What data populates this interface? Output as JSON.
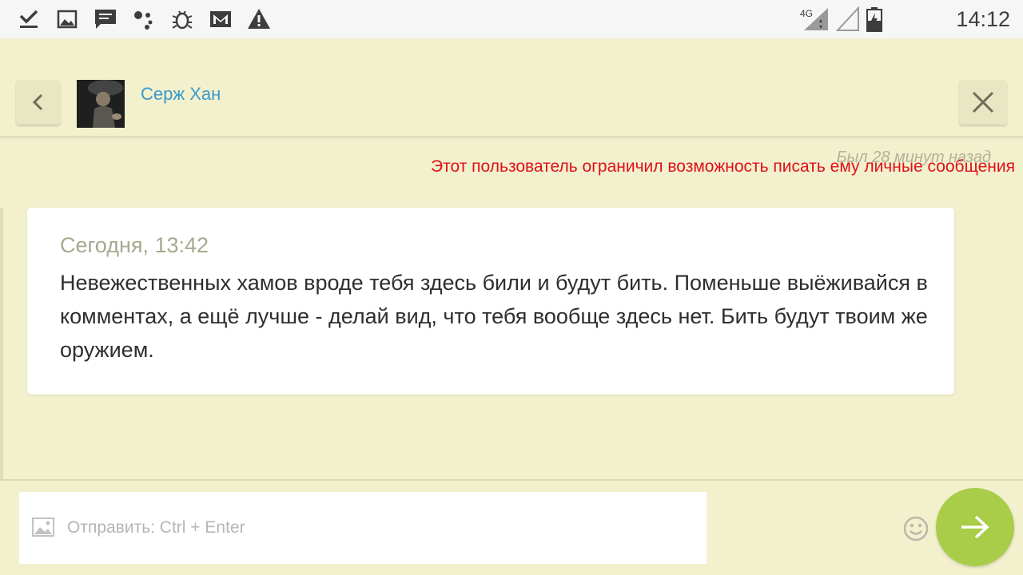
{
  "status_bar": {
    "time": "14:12",
    "network": "4G",
    "icons": [
      "download-done-icon",
      "image-icon",
      "message-icon",
      "assistant-icon",
      "bug-icon",
      "gmail-icon",
      "warning-icon",
      "signal-icon",
      "signal-empty-icon",
      "battery-charging-icon"
    ]
  },
  "header": {
    "user_name": "Серж Хан",
    "back_icon": "chevron-left-icon",
    "close_icon": "close-icon"
  },
  "notice": {
    "last_seen": "Был 28 минут назад",
    "restriction": "Этот пользователь ограничил возможность писать ему личные сообщения"
  },
  "message": {
    "time": "Сегодня, 13:42",
    "text": "Невежественных хамов вроде тебя здесь били и будут бить. Поменьше выёживайся в комментах, а ещё лучше - делай вид, что тебя вообще здесь нет. Бить будут твоим же оружием."
  },
  "composer": {
    "placeholder": "Отправить: Ctrl + Enter",
    "value": "",
    "attach_icon": "image-icon",
    "emoji_icon": "smiley-icon",
    "send_icon": "arrow-right-icon"
  },
  "colors": {
    "background": "#f2f0cd",
    "link": "#3b9acb",
    "warning": "#e0101a",
    "send_button": "#a9cd48"
  }
}
